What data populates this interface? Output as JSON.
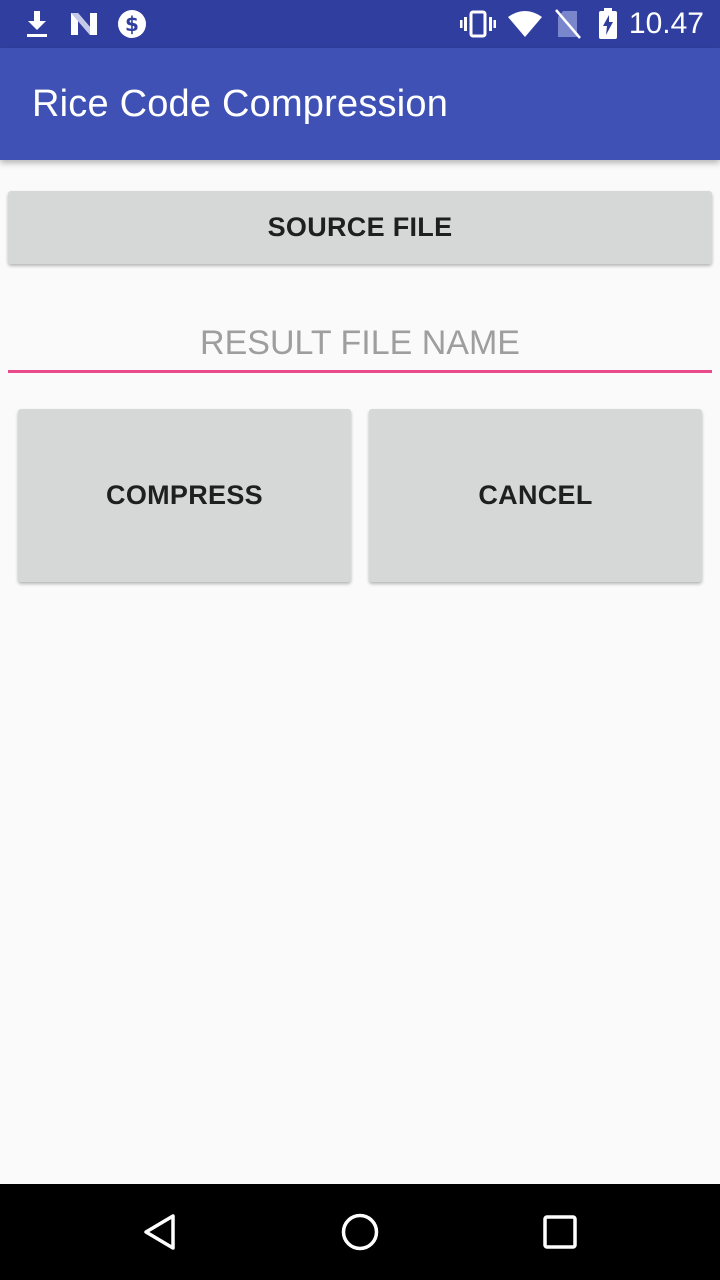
{
  "status_bar": {
    "time": "10.47",
    "left_icons": [
      "download-icon",
      "n-notification-icon",
      "dollar-icon"
    ],
    "right_icons": [
      "vibrate-icon",
      "wifi-icon",
      "no-sim-icon",
      "battery-charging-icon"
    ]
  },
  "app_bar": {
    "title": "Rice Code Compression"
  },
  "main": {
    "source_button_label": "SOURCE FILE",
    "result_field": {
      "value": "",
      "placeholder": "RESULT FILE NAME"
    },
    "compress_button_label": "COMPRESS",
    "cancel_button_label": "CANCEL"
  },
  "nav_bar": {
    "buttons": [
      "back-icon",
      "home-icon",
      "recents-icon"
    ]
  },
  "colors": {
    "status_bar": "#303f9f",
    "app_bar": "#3f51b5",
    "accent_underline": "#e84a8a",
    "button_bg": "#d6d7d7",
    "page_bg": "#fafafa"
  }
}
